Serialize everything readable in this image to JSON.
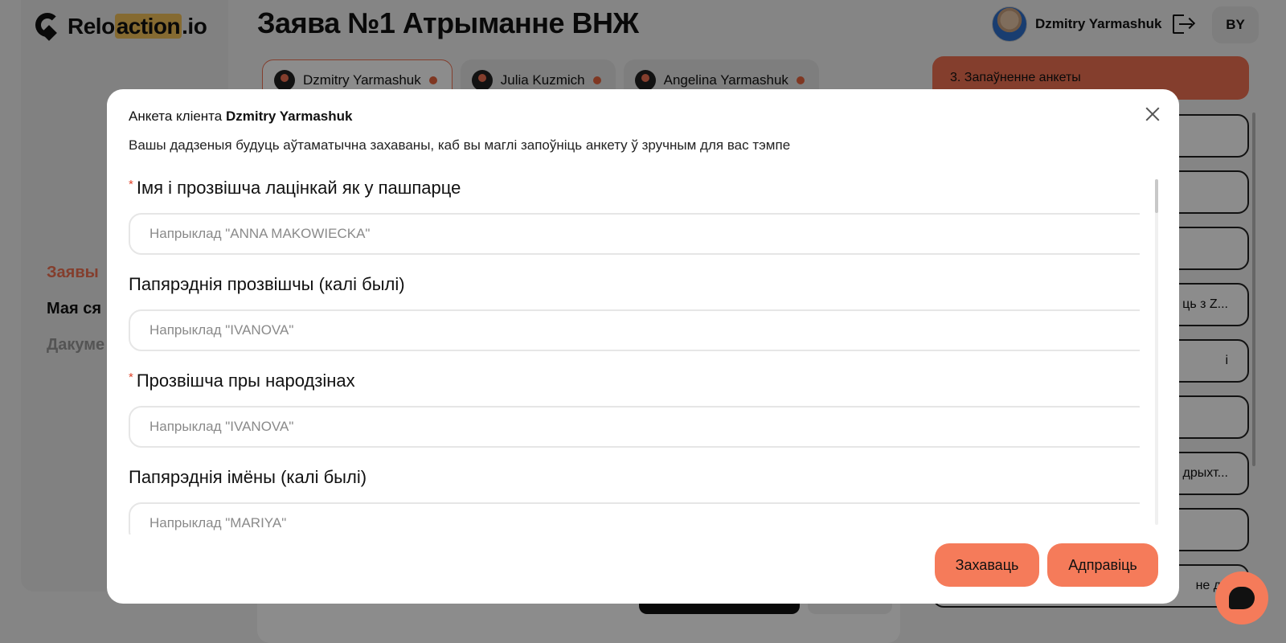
{
  "app": {
    "logo_prefix": "Relo",
    "logo_highlight": "action",
    "logo_suffix": ".io",
    "page_title": "Заява №1 Атрыманне ВНЖ",
    "user_name": "Dzmitry Yarmashuk",
    "language": "BY"
  },
  "sidebar": {
    "items": [
      {
        "label": "Заявы"
      },
      {
        "label": "Мая ся"
      },
      {
        "label": "Дакуме"
      }
    ]
  },
  "applicant_tabs": [
    {
      "name": "Dzmitry Yarmashuk"
    },
    {
      "name": "Julia Kuzmich"
    },
    {
      "name": "Angelina Yarmashuk"
    }
  ],
  "stages": {
    "active": "3. Запаўненне анкеты",
    "visible_fragments": [
      "",
      "",
      "",
      "ць з Z...",
      "і",
      "",
      "дрыхт...",
      "",
      "не да"
    ]
  },
  "modal": {
    "title_prefix": "Анкета кліента",
    "title_name": "Dzmitry Yarmashuk",
    "subtitle": "Вашы дадзеныя будуць аўтаматычна захаваны, каб вы маглі запоўніць анкету ў зручным для вас тэмпе",
    "fields": [
      {
        "label": "Імя і прозвішча лацінкай як у пашпарце",
        "required": "*",
        "placeholder": "Напрыклад \"ANNA MAKOWIECKA\"",
        "value": ""
      },
      {
        "label": "Папярэднія прозвішчы (калі былі)",
        "required": "",
        "placeholder": "Напрыклад \"IVANOVA\"",
        "value": ""
      },
      {
        "label": "Прозвішча пры народзінах",
        "required": "*",
        "placeholder": "Напрыклад \"IVANOVA\"",
        "value": ""
      },
      {
        "label": "Папярэднія імёны (калі былі)",
        "required": "",
        "placeholder": "Напрыклад \"MARIYA\"",
        "value": ""
      }
    ],
    "save_label": "Захаваць",
    "send_label": "Адправіць"
  },
  "colors": {
    "accent": "#f07152",
    "button": "#f57b5a",
    "required": "#e0432a",
    "logo_highlight": "#f2c25a"
  },
  "icons": [
    "logo-icon",
    "logout-icon",
    "close-icon",
    "chat-icon"
  ]
}
